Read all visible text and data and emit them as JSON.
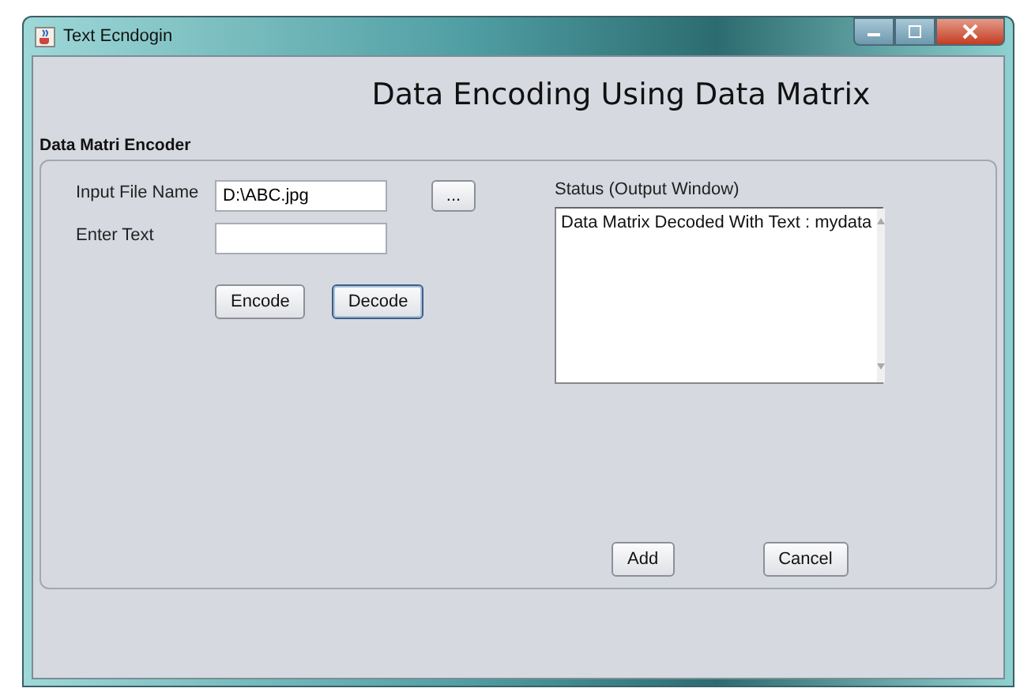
{
  "window": {
    "title": "Text Ecndogin"
  },
  "heading": "Data Encoding Using Data Matrix",
  "group": {
    "title": "Data Matri Encoder"
  },
  "fields": [
    {
      "label": "Input File Name",
      "value": "D:\\ABC.jpg"
    },
    {
      "label": "Enter Text"
    }
  ],
  "browse_button": "...",
  "actions": [
    {
      "label": "Encode",
      "focused": false
    },
    {
      "label": "Decode",
      "focused": true
    }
  ],
  "status": {
    "label": "Status (Output Window)",
    "text": "Data Matrix Decoded With Text : mydata"
  },
  "bottom_buttons": [
    {
      "label": "Add",
      "focused": false
    },
    {
      "label": "Cancel",
      "focused": false
    }
  ]
}
